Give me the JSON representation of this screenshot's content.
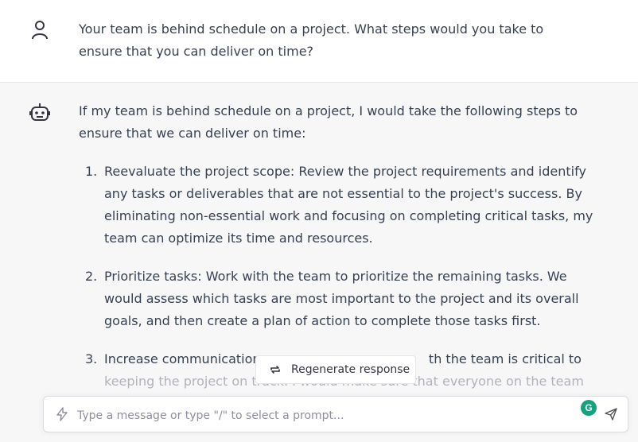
{
  "user_message": {
    "text": "Your team is behind schedule on a project. What steps would you take to ensure that you can deliver on time?"
  },
  "assistant_message": {
    "intro": "If my team is behind schedule on a project, I would take the following steps to ensure that we can deliver on time:",
    "steps": [
      {
        "num": "1.",
        "text": "Reevaluate the project scope: Review the project requirements and identify any tasks or deliverables that are not essential to the project's success. By eliminating non-essential work and focusing on completing critical tasks, my team can optimize its time and resources."
      },
      {
        "num": "2.",
        "text": "Prioritize tasks: Work with the team to prioritize the remaining tasks. We would assess which tasks are most important to the project and its overall goals, and then create a plan of action to complete those tasks first."
      },
      {
        "num": "3.",
        "text_visible": "Increase communication:",
        "text_tail": "th the team is critical to",
        "text_faded": "keeping the project on track. I would make sure that everyone on the team is"
      }
    ]
  },
  "regenerate_button": {
    "label": "Regenerate response"
  },
  "input": {
    "placeholder": "Type a message or type \"/\" to select a prompt...",
    "value": ""
  },
  "icons": {
    "user_avatar": "person-icon",
    "bot_avatar": "robot-icon",
    "regenerate": "refresh-icon",
    "prompt": "lightning-icon",
    "send": "send-icon",
    "extension": "grammarly-icon"
  },
  "extension_badge": {
    "label": "G"
  },
  "colors": {
    "accent": "#15a37f",
    "assistant_bg": "#f7f7f8",
    "text": "#374151"
  }
}
